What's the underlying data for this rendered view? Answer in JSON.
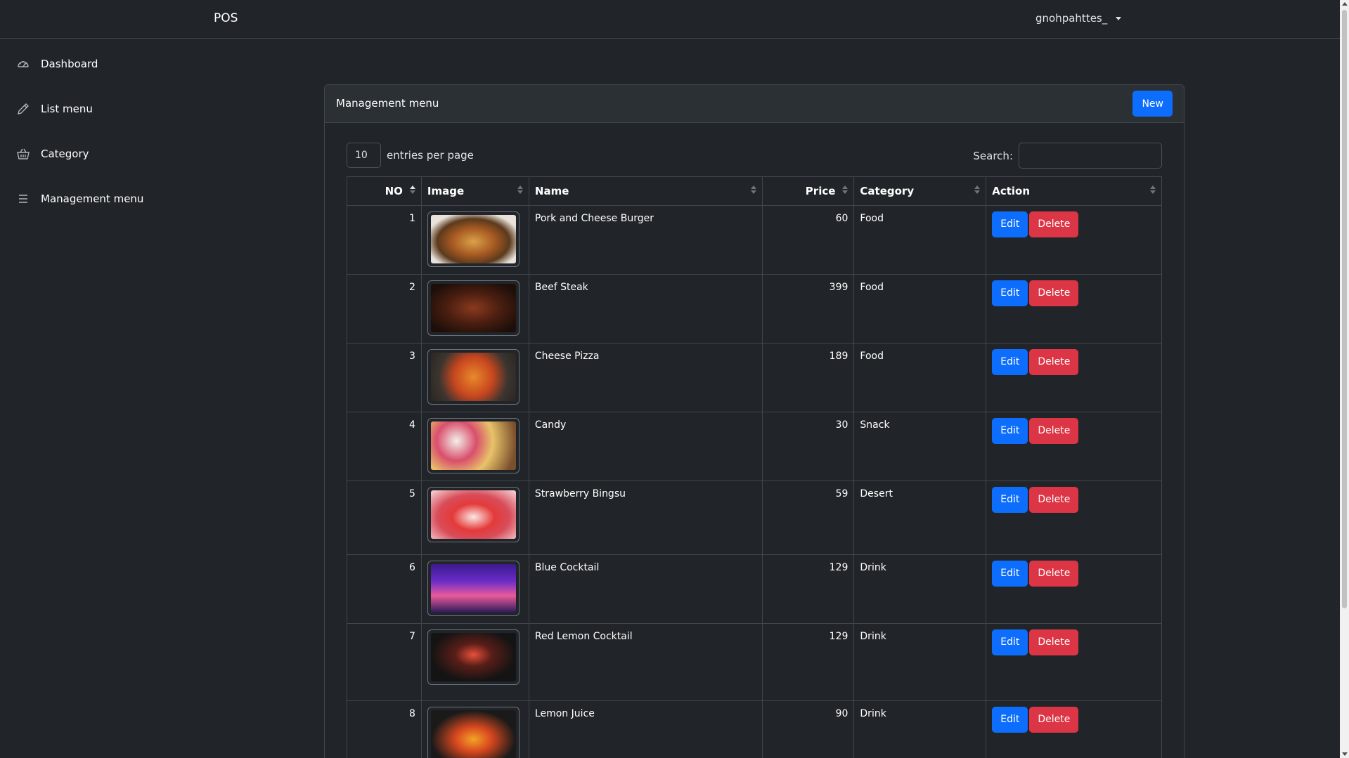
{
  "topbar": {
    "brand": "POS",
    "user": "gnohpahttes_"
  },
  "sidebar": {
    "items": [
      {
        "label": "Dashboard",
        "icon": "speedometer-icon"
      },
      {
        "label": "List menu",
        "icon": "pencil-icon"
      },
      {
        "label": "Category",
        "icon": "basket-icon"
      },
      {
        "label": "Management menu",
        "icon": "list-icon"
      }
    ]
  },
  "card": {
    "title": "Management menu",
    "new_label": "New",
    "entries_value": "10",
    "entries_label": "entries per page",
    "search_label": "Search:"
  },
  "table": {
    "headers": [
      "NO",
      "Image",
      "Name",
      "Price",
      "Category",
      "Action"
    ],
    "edit_label": "Edit",
    "delete_label": "Delete",
    "rows": [
      {
        "no": "1",
        "name": "Pork and Cheese Burger",
        "price": "60",
        "category": "Food",
        "image": "burger-photo"
      },
      {
        "no": "2",
        "name": "Beef Steak",
        "price": "399",
        "category": "Food",
        "image": "steak-photo"
      },
      {
        "no": "3",
        "name": "Cheese Pizza",
        "price": "189",
        "category": "Food",
        "image": "pizza-photo"
      },
      {
        "no": "4",
        "name": "Candy",
        "price": "30",
        "category": "Snack",
        "image": "candy-photo"
      },
      {
        "no": "5",
        "name": "Strawberry Bingsu",
        "price": "59",
        "category": "Desert",
        "image": "bingsu-photo"
      },
      {
        "no": "6",
        "name": "Blue Cocktail",
        "price": "129",
        "category": "Drink",
        "image": "blue-cocktail-photo"
      },
      {
        "no": "7",
        "name": "Red Lemon Cocktail",
        "price": "129",
        "category": "Drink",
        "image": "red-cocktail-photo"
      },
      {
        "no": "8",
        "name": "Lemon Juice",
        "price": "90",
        "category": "Drink",
        "image": "lemon-juice-photo"
      }
    ]
  },
  "colors": {
    "primary": "#0d6efd",
    "danger": "#dc3545",
    "background": "#212529"
  }
}
